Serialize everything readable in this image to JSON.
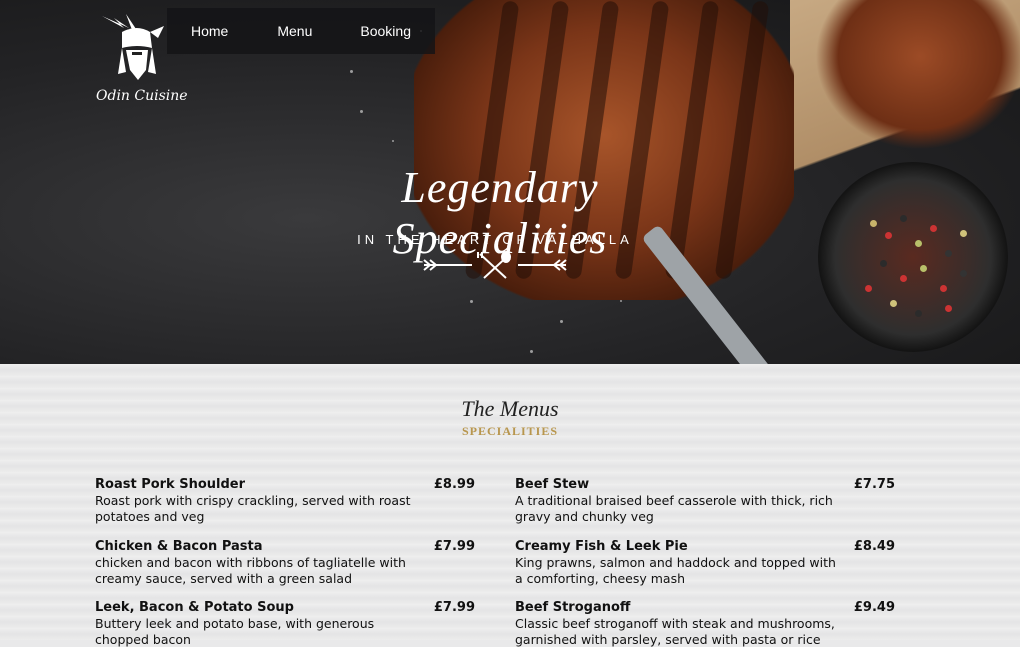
{
  "brand": {
    "name": "Odin Cuisine"
  },
  "nav": {
    "items": [
      "Home",
      "Menu",
      "Booking"
    ]
  },
  "hero": {
    "title": "Legendary Specialities",
    "subtitle": "IN THE HEART OF VALHALLA"
  },
  "menus": {
    "title": "The Menus",
    "subtitle": "SPECIALITIES",
    "left": [
      {
        "name": "Roast Pork Shoulder",
        "price": "£8.99",
        "desc": "Roast pork with crispy crackling, served with roast potatoes and veg"
      },
      {
        "name": "Chicken & Bacon Pasta",
        "price": "£7.99",
        "desc": "chicken and bacon with ribbons of tagliatelle with creamy sauce, served with a green salad"
      },
      {
        "name": "Leek, Bacon & Potato Soup",
        "price": "£7.99",
        "desc": "Buttery leek and potato base, with generous chopped bacon"
      }
    ],
    "right": [
      {
        "name": "Beef Stew",
        "price": "£7.75",
        "desc": "A traditional braised beef casserole with thick, rich gravy and chunky veg"
      },
      {
        "name": "Creamy Fish & Leek Pie",
        "price": "£8.49",
        "desc": "King prawns, salmon and haddock and topped with a comforting, cheesy mash"
      },
      {
        "name": "Beef Stroganoff",
        "price": "£9.49",
        "desc": "Classic beef stroganoff with steak and mushrooms, garnished with parsley, served with pasta or rice"
      }
    ]
  },
  "colors": {
    "accent_gold": "#b8964d",
    "nav_bg": "#141416"
  }
}
